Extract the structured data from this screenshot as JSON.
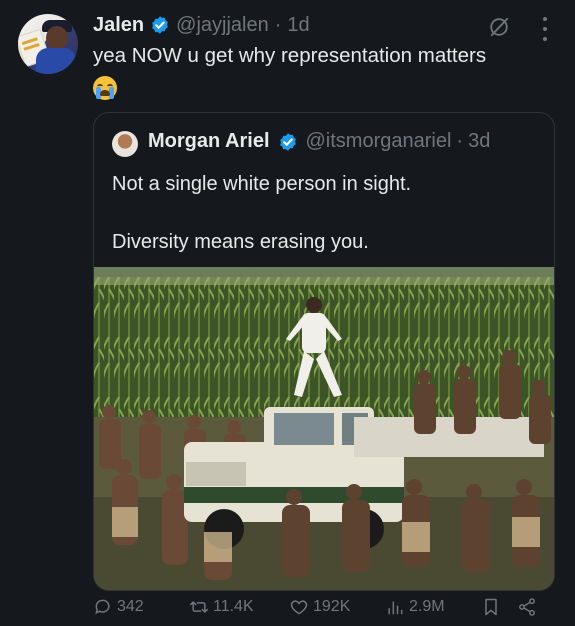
{
  "tweet": {
    "author_name": "Jalen",
    "handle": "@jayjjalen",
    "separator": "·",
    "time": "1d",
    "text": "yea NOW u get why representation matters",
    "emoji": "loudly-crying-face"
  },
  "quoted": {
    "author_name": "Morgan Ariel",
    "handle": "@itsmorganariel",
    "separator": "·",
    "time": "3d",
    "line1": "Not a single white person in sight.",
    "line2": "Diversity means erasing you."
  },
  "actions": {
    "replies": "342",
    "reposts": "11.4K",
    "likes": "192K",
    "views": "2.9M"
  },
  "colors": {
    "background": "#15181c",
    "text": "#e7e9ea",
    "muted": "#71767b",
    "verified": "#1d9bf0",
    "border": "#2f3336"
  }
}
